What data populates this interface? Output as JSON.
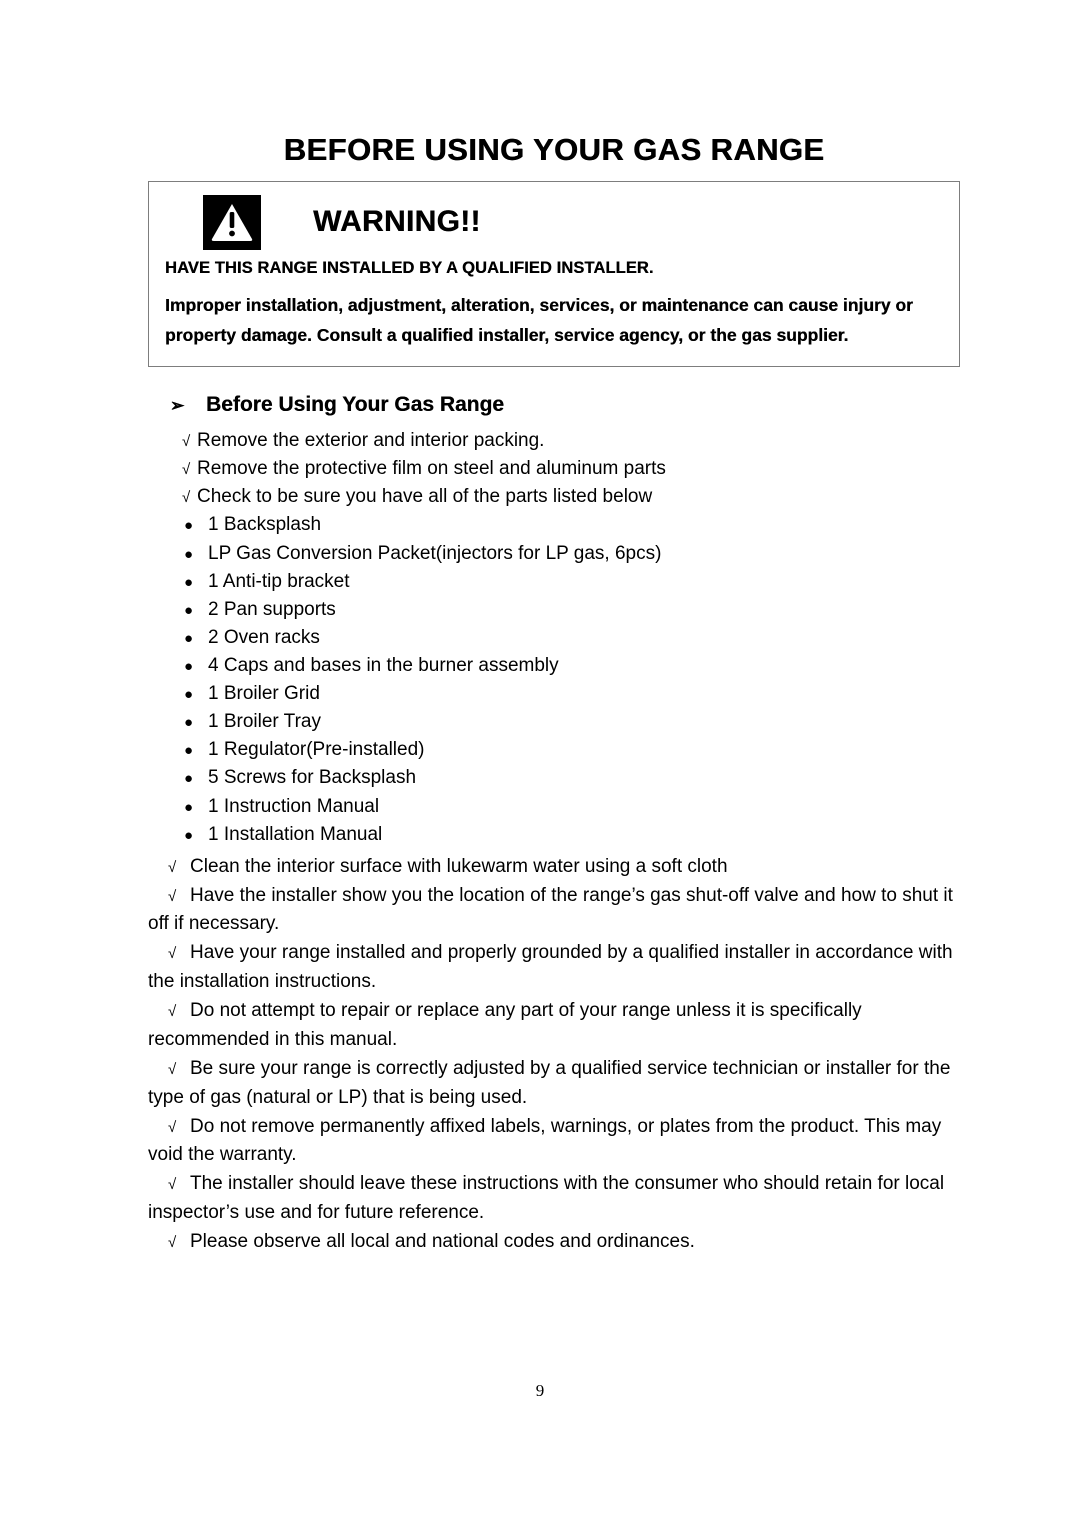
{
  "document": {
    "title": "BEFORE USING YOUR GAS RANGE",
    "page_number": "9"
  },
  "warning": {
    "icon": "warning-triangle-icon",
    "title": "WARNING!!",
    "subtitle": "HAVE THIS RANGE INSTALLED BY A QUALIFIED INSTALLER.",
    "body": "Improper installation, adjustment, alteration, services, or maintenance can cause injury or property damage.  Consult a qualified installer, service agency, or the gas supplier.",
    "border_color": "#7d7d7d"
  },
  "section": {
    "arrow_glyph": "➢",
    "heading": "Before Using Your Gas Range",
    "check_glyph": "√",
    "dot_glyph": "●",
    "intro_checks": [
      "Remove the exterior and interior packing.",
      "Remove the protective film on steel and aluminum parts",
      "Check to be sure you have all of the parts listed below"
    ],
    "parts": [
      "1 Backsplash",
      "LP Gas Conversion Packet(injectors for LP gas, 6pcs)",
      "1 Anti-tip bracket",
      "2 Pan supports",
      "2 Oven racks",
      "4 Caps and bases in the burner assembly",
      "1 Broiler Grid",
      "1 Broiler Tray",
      "1 Regulator(Pre-installed)",
      "5 Screws for Backsplash",
      "1 Instruction Manual",
      "1 Installation Manual"
    ],
    "instructions": [
      "Clean the interior surface with lukewarm water using a soft cloth",
      "Have the installer show you the location of the range’s gas shut-off valve and how to shut it off if necessary.",
      "Have your range installed and properly grounded by a qualified installer in accordance with the installation instructions.",
      "Do not attempt to repair or replace any part of your range unless it is specifically recommended in this manual.",
      "Be sure your range is correctly adjusted by a qualified service technician or installer for the type of gas (natural or LP) that is being used.",
      "Do not remove permanently affixed labels, warnings, or plates from the product.  This may void the warranty.",
      "The installer should leave these instructions with the consumer who should retain for local inspector’s use and for future reference.",
      "Please observe all local and national codes and ordinances."
    ]
  }
}
